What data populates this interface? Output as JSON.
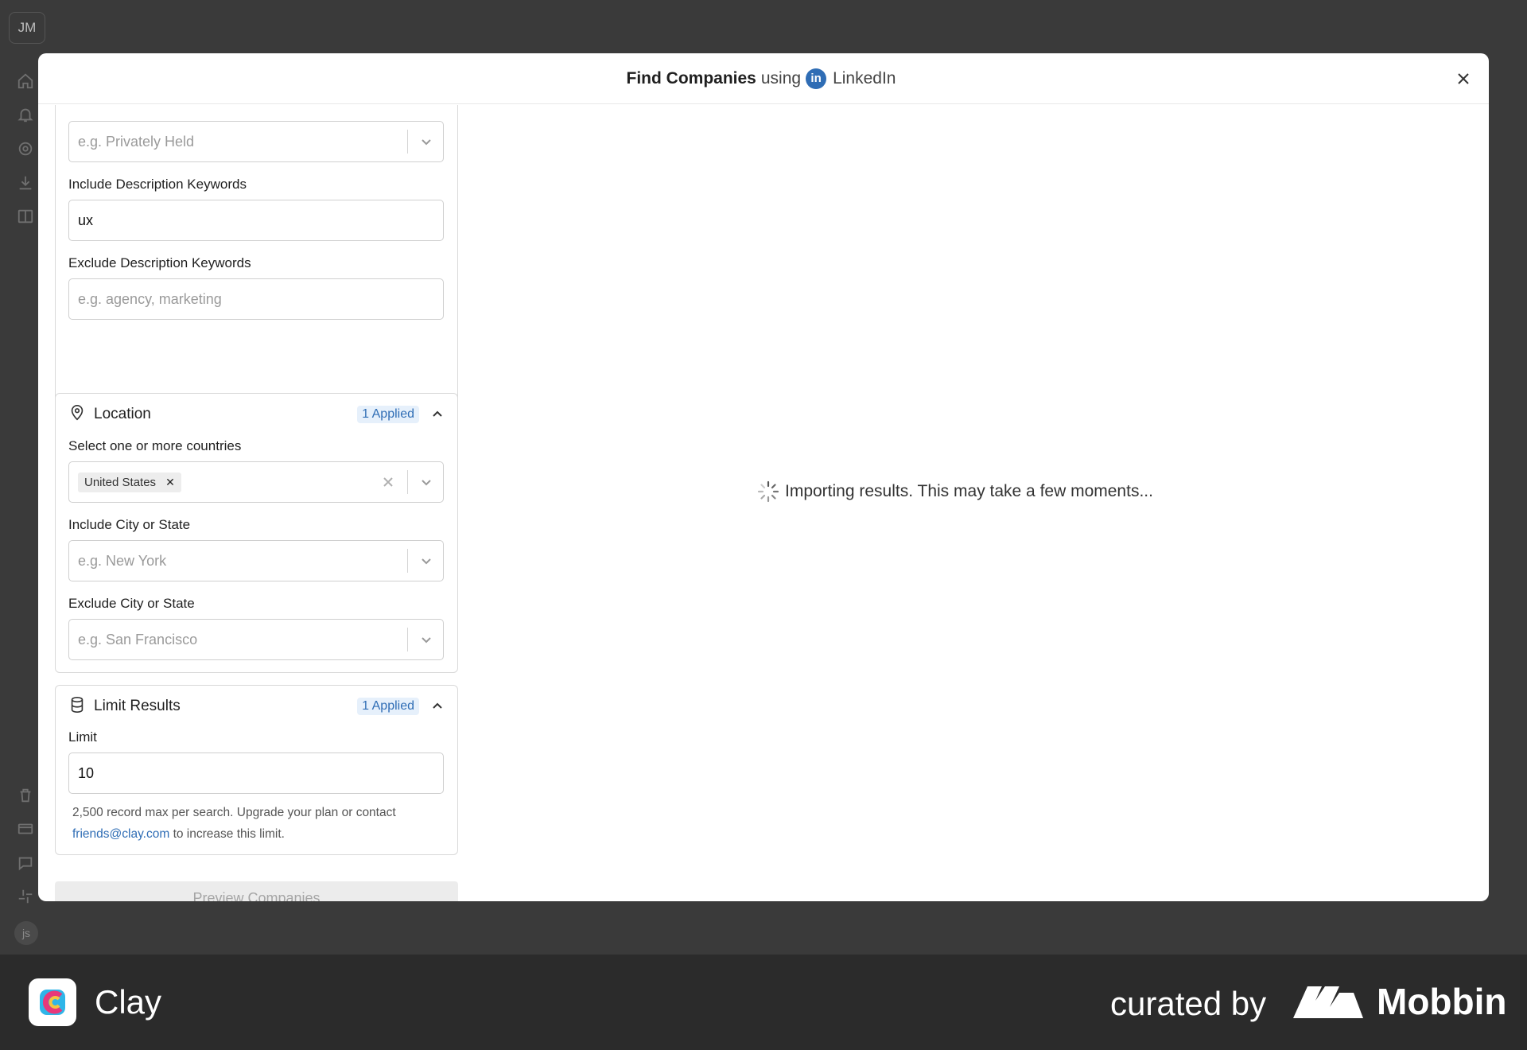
{
  "app": {
    "avatar_initials": "JM",
    "user_badge": "js"
  },
  "modal": {
    "title_strong": "Find Companies",
    "title_using": "using",
    "provider_icon_text": "in",
    "provider_name": "LinkedIn"
  },
  "filters": {
    "company_type_placeholder": "e.g. Privately Held",
    "include_desc_label": "Include Description Keywords",
    "include_desc_value": "ux",
    "exclude_desc_label": "Exclude Description Keywords",
    "exclude_desc_placeholder": "e.g. agency, marketing"
  },
  "location": {
    "title": "Location",
    "applied": "1 Applied",
    "countries_label": "Select one or more countries",
    "selected_country": "United States",
    "include_city_label": "Include City or State",
    "include_city_placeholder": "e.g. New York",
    "exclude_city_label": "Exclude City or State",
    "exclude_city_placeholder": "e.g. San Francisco"
  },
  "limit": {
    "title": "Limit Results",
    "applied": "1 Applied",
    "label": "Limit",
    "value": "10",
    "help_text": "2,500 record max per search. Upgrade your plan or contact",
    "help_email": "friends@clay.com",
    "help_suffix": "to increase this limit."
  },
  "preview_button": "Preview Companies",
  "status": "Importing results. This may take a few moments...",
  "footer": {
    "brand": "Clay",
    "curated_by": "curated by",
    "curator": "Mobbin"
  },
  "colors": {
    "accent": "#2f6db5",
    "applied_bg": "#e6f0fb"
  }
}
